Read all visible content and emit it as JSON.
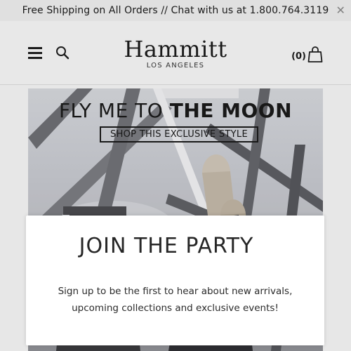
{
  "announcement": {
    "text": "Free Shipping on All Orders // Chat with us at 1.800.764.3119",
    "close_icon": "close-icon"
  },
  "header": {
    "menu_icon": "hamburger-menu-icon",
    "search_icon": "search-icon",
    "logo_name": "Hammitt",
    "logo_sub": "LOS ANGELES",
    "cart_count": "(0)",
    "cart_icon": "shopping-bag-icon"
  },
  "hero": {
    "title_light": "FLY ME TO",
    "title_bold": "THE MOON",
    "cta_label": "SHOP THIS EXCLUSIVE STYLE"
  },
  "modal": {
    "title": "JOIN THE PARTY",
    "body_line1": "Sign up to be the first to hear about new arrivals,",
    "body_line2": "upcoming collections and exclusive events!"
  }
}
